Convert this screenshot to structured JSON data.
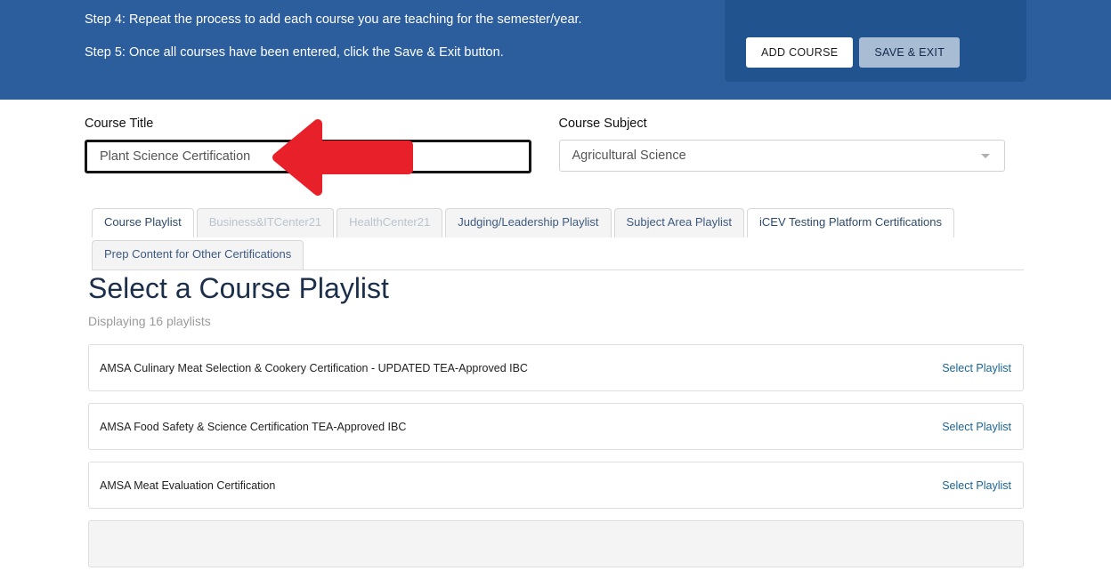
{
  "header": {
    "steps": [
      "Step 4: Repeat the process to add each course you are teaching for the semester/year.",
      "Step 5: Once all courses have been entered, click the Save & Exit button."
    ],
    "buttons": {
      "add_course": "ADD COURSE",
      "save_exit": "SAVE & EXIT"
    },
    "colors": {
      "band": "#2c5e9e",
      "panel": "#21538f",
      "save_button": "#a8bdd4"
    }
  },
  "form": {
    "course_title": {
      "label": "Course Title",
      "value": "Plant Science Certification"
    },
    "course_subject": {
      "label": "Course Subject",
      "value": "Agricultural Science",
      "caret_icon": "chevron-down-icon"
    }
  },
  "annotation": {
    "arrow_icon": "left-arrow-icon",
    "color": "#e8202a"
  },
  "tabs": [
    {
      "label": "Course Playlist",
      "state": "active"
    },
    {
      "label": "Business&ITCenter21",
      "state": "disabled"
    },
    {
      "label": "HealthCenter21",
      "state": "disabled"
    },
    {
      "label": "Judging/Leadership Playlist",
      "state": "normal"
    },
    {
      "label": "Subject Area Playlist",
      "state": "normal"
    },
    {
      "label": "iCEV Testing Platform Certifications",
      "state": "normal"
    },
    {
      "label": "Prep Content for Other Certifications",
      "state": "normal"
    }
  ],
  "playlist": {
    "title": "Select a Course Playlist",
    "count_text": "Displaying 16 playlists",
    "action_label": "Select Playlist",
    "rows": [
      {
        "title": "AMSA Culinary Meat Selection & Cookery Certification - UPDATED TEA-Approved IBC",
        "hovered": false
      },
      {
        "title": "AMSA Food Safety & Science Certification TEA-Approved IBC",
        "hovered": false
      },
      {
        "title": "AMSA Meat Evaluation Certification",
        "hovered": false
      },
      {
        "title": "",
        "hovered": true
      }
    ]
  }
}
